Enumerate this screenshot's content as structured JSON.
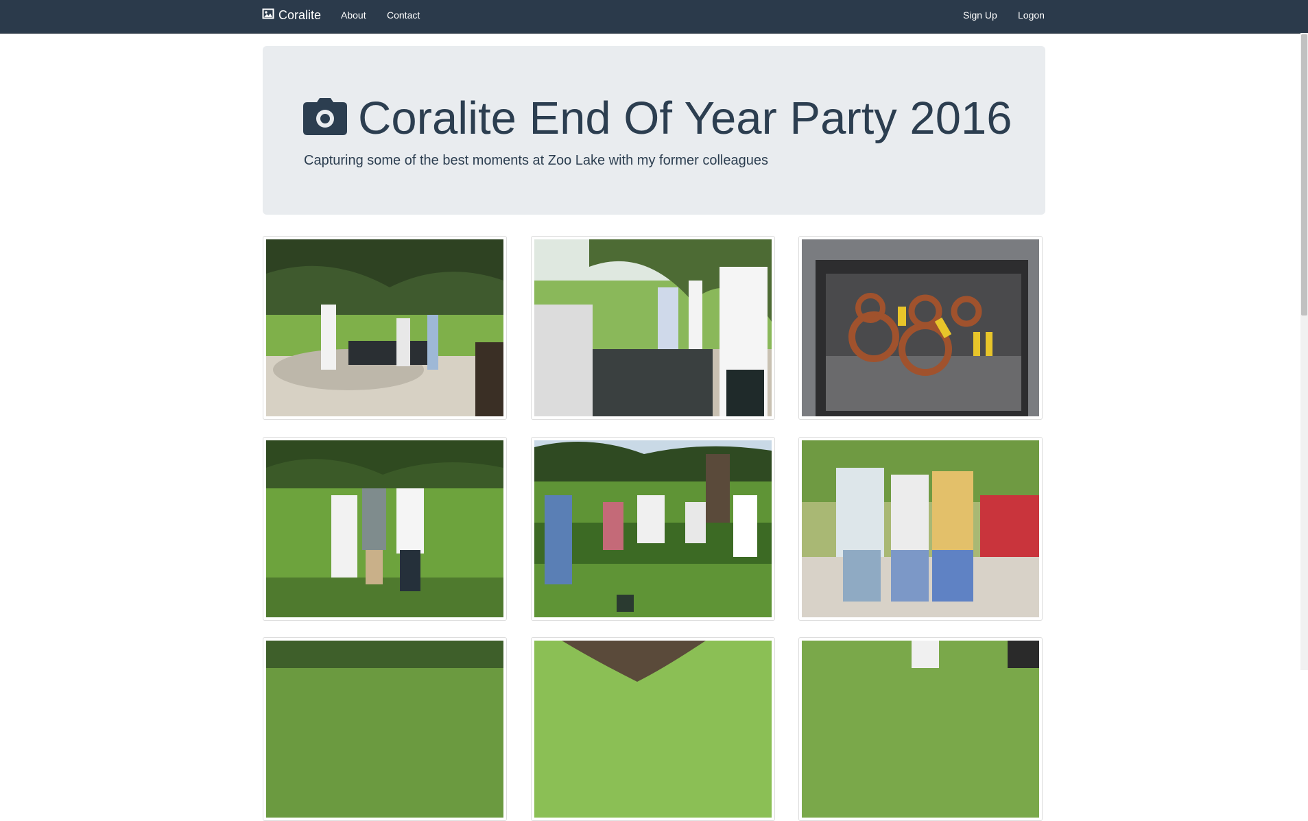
{
  "navbar": {
    "brand": "Coralite",
    "links": [
      "About",
      "Contact"
    ],
    "right_links": [
      "Sign Up",
      "Logon"
    ],
    "brand_icon": "picture-icon"
  },
  "hero": {
    "icon": "camera-icon",
    "title": "Coralite End Of Year Party 2016",
    "lead": "Capturing some of the best moments at Zoo Lake with my former colleagues"
  },
  "gallery": {
    "photos": [
      {
        "alt": "photo-1"
      },
      {
        "alt": "photo-2"
      },
      {
        "alt": "photo-3"
      },
      {
        "alt": "photo-4"
      },
      {
        "alt": "photo-5"
      },
      {
        "alt": "photo-6"
      },
      {
        "alt": "photo-7"
      },
      {
        "alt": "photo-8"
      },
      {
        "alt": "photo-9"
      }
    ]
  },
  "colors": {
    "navbar_bg": "#2b3a4b",
    "jumbotron_bg": "#e9ecef",
    "text": "#2c3e50"
  }
}
